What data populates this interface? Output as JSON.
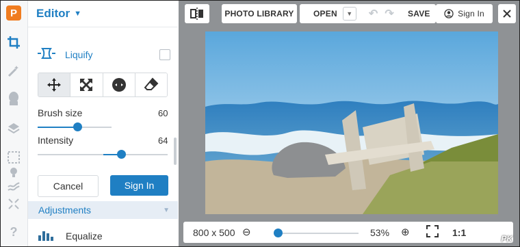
{
  "rail": {
    "icons": [
      "logo-icon",
      "crop-icon",
      "magic-wand-icon",
      "portrait-icon",
      "layers-icon",
      "frame-icon",
      "light-bulb-icon",
      "texture-icon",
      "resize-icon",
      "help-icon"
    ],
    "logo_glyph": "P",
    "help_glyph": "?"
  },
  "panel": {
    "title": "Editor",
    "tool_name": "Liquify",
    "brush_size_label": "Brush size",
    "brush_size_value": "60",
    "brush_size_level": 0.6,
    "intensity_label": "Intensity",
    "intensity_value": "64",
    "intensity_level": 0.64,
    "cancel_label": "Cancel",
    "signin_label": "Sign In",
    "adjustments_label": "Adjustments",
    "equalize_label": "Equalize"
  },
  "toolbar": {
    "photo_library": "PHOTO LIBRARY",
    "open": "OPEN",
    "save": "SAVE",
    "sign_in": "Sign In"
  },
  "bottom": {
    "dimensions": "800 x 500",
    "zoom_percent": "53%",
    "zoom_level": 0.53,
    "one_to_one": "1:1"
  },
  "watermark": "PK",
  "colors": {
    "accent": "#1f7fc3",
    "logo": "#f07c1f",
    "canvas_bg": "#8f9295"
  }
}
